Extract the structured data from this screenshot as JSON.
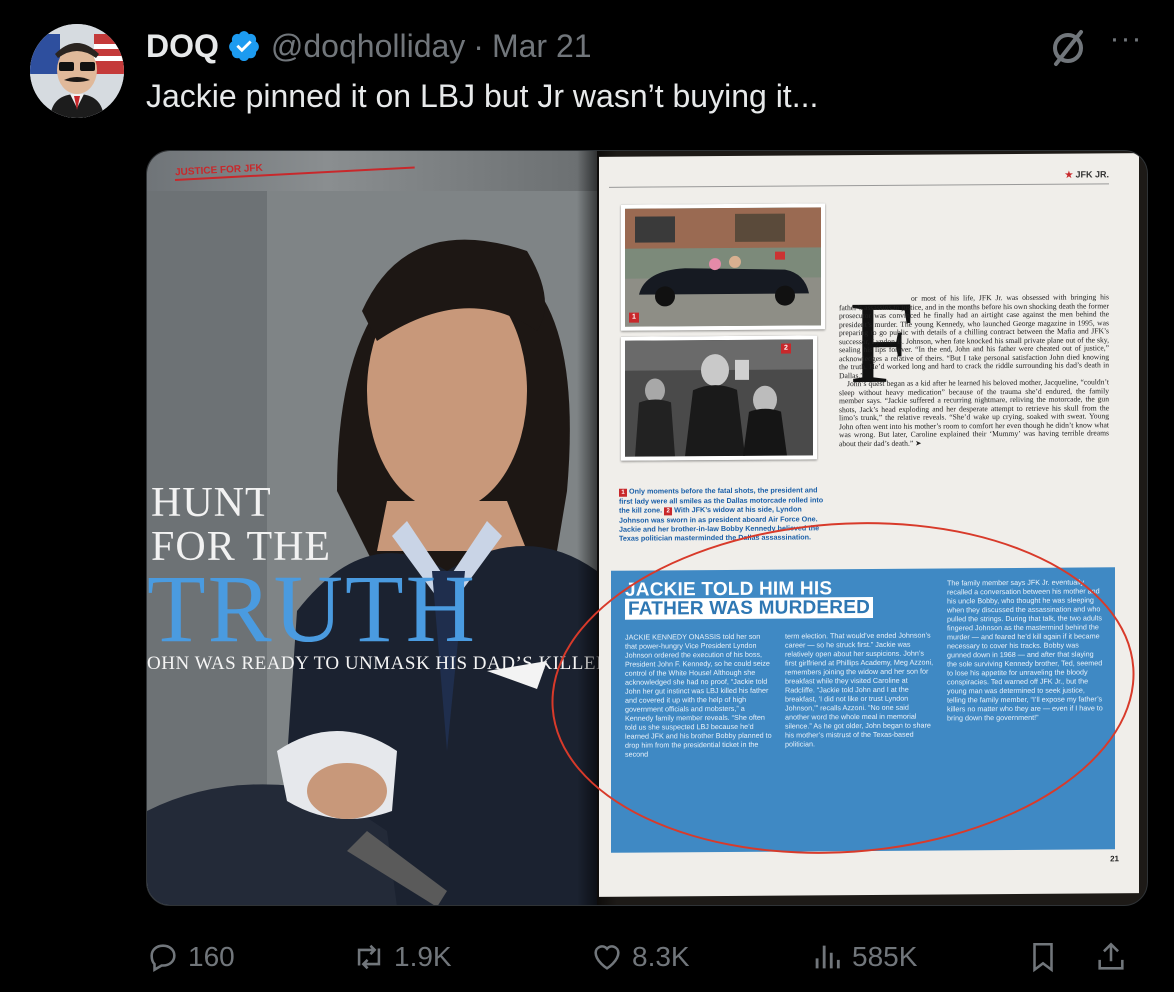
{
  "tweet": {
    "author_name": "DOQ",
    "handle": "@doqholliday",
    "separator": "·",
    "date": "Mar 21",
    "more_label": "···",
    "text": "Jackie pinned it on LBJ but Jr wasn’t buying it..."
  },
  "magazine": {
    "section_tag": "JUSTICE FOR JFK",
    "hunt_line1": "HUNT",
    "hunt_line2": "FOR THE",
    "truth": "TRUTH",
    "kicker": "OHN WAS READY TO UNMASK HIS DAD’S KILLERS",
    "running_head": "JFK JR.",
    "photo1_num": "1",
    "photo2_num": "2",
    "caption_num1": "1",
    "caption_text1": "Only moments before the fatal shots, the president and first lady were all smiles as the Dallas motorcade rolled into the kill zone.",
    "caption_num2": "2",
    "caption_text2": "With JFK’s widow at his side, Lyndon Johnson was sworn in as president aboard Air Force One. Jackie and her brother-in-law Bobby Kennedy believed the Texas politician masterminded the Dallas assassination.",
    "dropcap": "F",
    "body_p1": "or most of his life, JFK Jr. was obsessed with bringing his father’s assassins to justice, and in the months before his own shocking death the former prosecutor was convinced he finally had an airtight case against the men behind the president’s murder. The young Kennedy, who launched George magazine in 1995, was preparing to go public with details of a chilling contract between the Mafia and JFK’s successor, Lyndon B. Johnson, when fate knocked his small private plane out of the sky, sealing his lips forever. “In the end, John and his father were cheated out of justice,” acknowledges a relative of theirs. “But I take personal satisfaction John died knowing the truth. He’d worked long and hard to crack the riddle surrounding his dad’s death in Dallas.”",
    "body_p2": "John’s quest began as a kid after he learned his beloved mother, Jacqueline, “couldn’t sleep without heavy medication” because of the trauma she’d endured, the family member says. “Jackie suffered a recurring nightmare, reliving the motorcade, the gun shots, Jack’s head exploding and her desperate attempt to retrieve his skull from the limo’s trunk,” the relative reveals. “She’d wake up crying, soaked with sweat. Young John often went into his mother’s room to comfort her even though he didn’t know what was wrong. But later, Caroline explained their ‘Mummy’ was having terrible dreams about their dad’s death.” ➤",
    "box_title_line1": "JACKIE TOLD HIM HIS",
    "box_title_line2": "FATHER WAS MURDERED",
    "box_col1": "JACKIE KENNEDY ONASSIS told her son that power-hungry Vice President Lyndon Johnson ordered the execution of his boss, President John F. Kennedy, so he could seize control of the White House! Although she acknowledged she had no proof, “Jackie told John her gut instinct was LBJ killed his father and covered it up with the help of high government officials and mobsters,” a Kennedy family member reveals. “She often told us she suspected LBJ because he’d learned JFK and his brother Bobby planned to drop him from the presidential ticket in the second",
    "box_col2": "term election. That would’ve ended Johnson’s career — so he struck first.” Jackie was relatively open about her suspicions. John’s first girlfriend at Phillips Academy, Meg Azzoni, remembers joining the widow and her son for breakfast while they visited Caroline at Radcliffe. “Jackie told John and I at the breakfast, ‘I did not like or trust Lyndon Johnson,’” recalls Azzoni. “No one said another word the whole meal in memorial silence.” As he got older, John began to share his mother’s mistrust of the Texas-based politician.",
    "box_col3": "The family member says JFK Jr. eventually recalled a conversation between his mother and his uncle Bobby, who thought he was sleeping when they discussed the assassination and who pulled the strings. During that talk, the two adults fingered Johnson as the mastermind behind the murder — and feared he’d kill again if it became necessary to cover his tracks. Bobby was gunned down in 1968 — and after that slaying the sole surviving Kennedy brother, Ted, seemed to lose his appetite for unraveling the bloody conspiracies. Ted warned off JFK Jr., but the young man was determined to seek justice, telling the family member, “I’ll expose my father’s killers no matter who they are — even if I have to bring down the government!”",
    "page_number": "21"
  },
  "actions": {
    "replies": "160",
    "reposts": "1.9K",
    "likes": "8.3K",
    "views": "585K"
  },
  "colors": {
    "background": "#000000",
    "text": "#e7e9ea",
    "muted": "#71767b",
    "verified": "#1d9bf0",
    "magazine_blue": "#3f89c4",
    "magazine_red": "#c8282b"
  },
  "icons": [
    "verified-badge-icon",
    "grok-icon",
    "more-icon",
    "reply-icon",
    "repost-icon",
    "like-icon",
    "views-icon",
    "bookmark-icon",
    "share-icon"
  ]
}
